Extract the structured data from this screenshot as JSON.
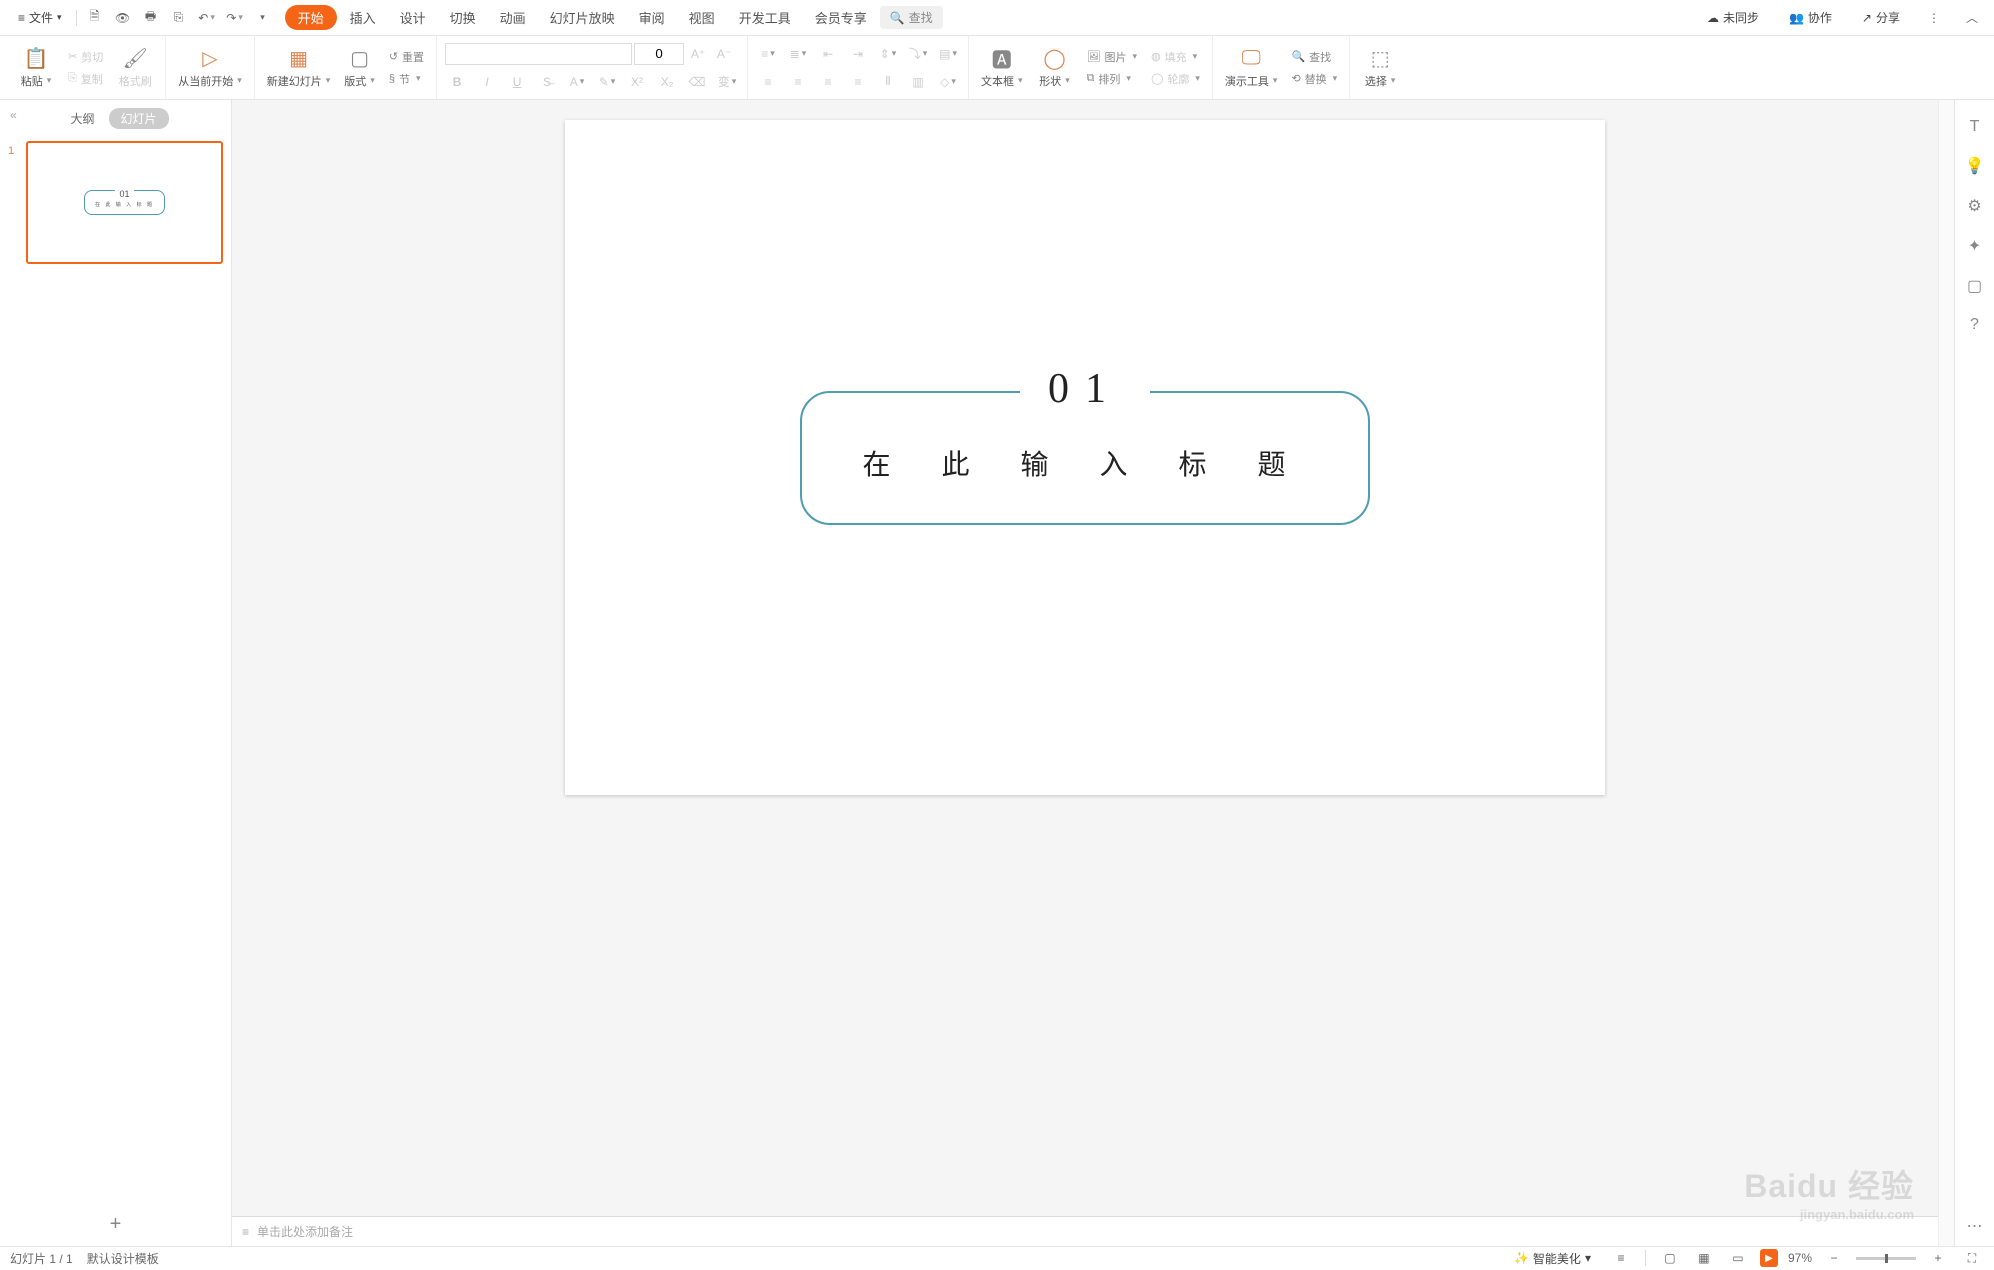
{
  "topmenu": {
    "file": "文件"
  },
  "tabs": {
    "start": "开始",
    "insert": "插入",
    "design": "设计",
    "transition": "切换",
    "animation": "动画",
    "slideshow": "幻灯片放映",
    "review": "审阅",
    "view": "视图",
    "devtools": "开发工具",
    "member": "会员专享"
  },
  "search": {
    "placeholder": "查找"
  },
  "topright": {
    "unsync": "未同步",
    "collab": "协作",
    "share": "分享"
  },
  "ribbon": {
    "paste": "粘贴",
    "cut": "剪切",
    "copy": "复制",
    "format_painter": "格式刷",
    "from_current": "从当前开始",
    "new_slide": "新建幻灯片",
    "layout": "版式",
    "section": "节",
    "reset": "重置",
    "font_size_value": "0",
    "textbox": "文本框",
    "shape": "形状",
    "picture": "图片",
    "arrange": "排列",
    "fill": "填充",
    "outline": "轮廓",
    "tools": "演示工具",
    "replace": "替换",
    "find": "查找",
    "select": "选择"
  },
  "panel": {
    "outline": "大纲",
    "slides": "幻灯片",
    "thumbs": [
      {
        "num": "1",
        "title_num": "01",
        "title_text": "在 此 输 入 标 题"
      }
    ]
  },
  "slide": {
    "title_num": "01",
    "title_text": "在 此 输 入 标 题"
  },
  "notes": {
    "placeholder": "单击此处添加备注"
  },
  "status": {
    "page": "幻灯片 1 / 1",
    "template": "默认设计模板",
    "beautify": "智能美化",
    "zoom": "97%"
  },
  "watermark": {
    "main": "Baidu 经验",
    "sub": "jingyan.baidu.com"
  }
}
